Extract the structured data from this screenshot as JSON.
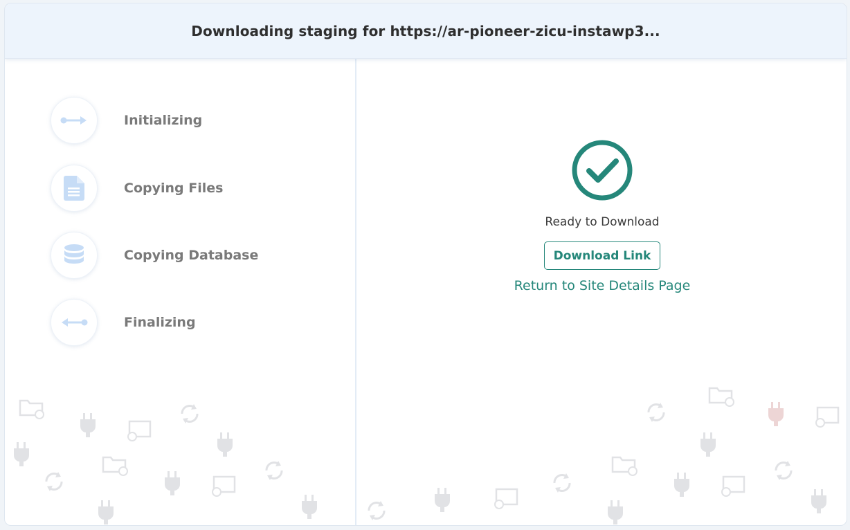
{
  "header": {
    "title": "Downloading staging for https://ar-pioneer-zicu-instawp3..."
  },
  "steps": [
    {
      "label": "Initializing",
      "icon": "arrow-right-icon"
    },
    {
      "label": "Copying Files",
      "icon": "file-icon"
    },
    {
      "label": "Copying Database",
      "icon": "database-icon"
    },
    {
      "label": "Finalizing",
      "icon": "arrow-left-icon"
    }
  ],
  "status": {
    "icon": "check-circle-icon",
    "text": "Ready to Download",
    "download_label": "Download Link",
    "return_label": "Return to Site Details Page"
  },
  "colors": {
    "accent": "#25877a",
    "header_bg": "#edf4fc",
    "step_icon": "#c6dcf6",
    "decor": "#d7dade",
    "decor_plug_red": "#e6c5c5"
  }
}
